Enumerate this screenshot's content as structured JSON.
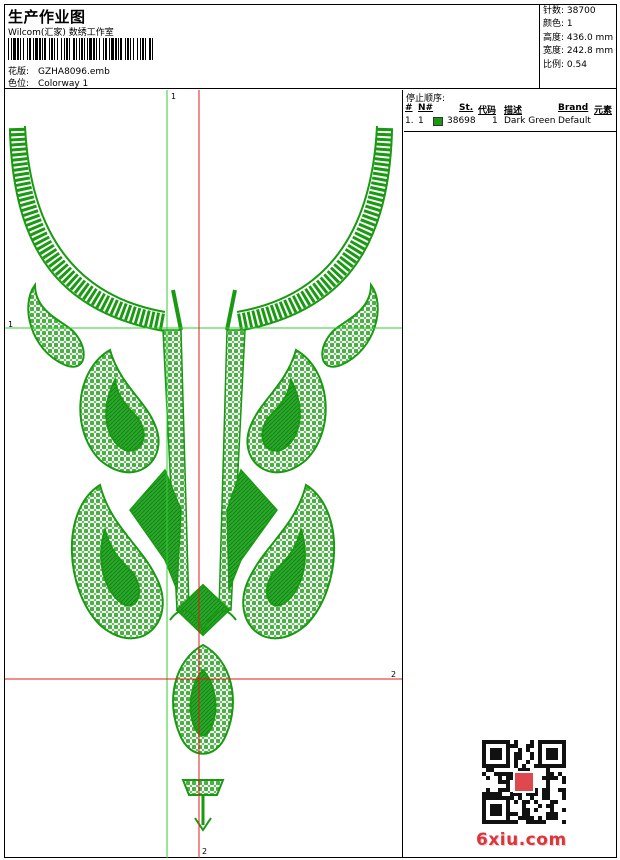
{
  "header": {
    "title": "生产作业图",
    "subtitle": "Wilcom(汇家) 数绣工作室",
    "design_label": "花版:",
    "design_value": "GZHA8096.emb",
    "color_label": "色位:",
    "color_value": "Colorway 1"
  },
  "stats": [
    {
      "label": "针数",
      "value": "38700"
    },
    {
      "label": "颜色",
      "value": "1"
    },
    {
      "label": "高度",
      "value": "436.0 mm"
    },
    {
      "label": "宽度",
      "value": "242.8 mm"
    },
    {
      "label": "比例",
      "value": "0.54"
    }
  ],
  "stop_sequence": {
    "title": "停止顺序:",
    "columns": [
      "#",
      "N#",
      "St.",
      "代码",
      "描述",
      "Brand",
      "元素"
    ],
    "rows": [
      {
        "num": "1.",
        "needle": "1",
        "swatch_color": "#1a9a12",
        "stitches": "38698",
        "code": "1",
        "description": "Dark Green",
        "brand": "Default",
        "elements": ""
      }
    ]
  },
  "guides": {
    "vertical_green_label": "1",
    "horizontal_green_label": "1",
    "horizontal_red_label": "2",
    "vertical_red_label": "2"
  },
  "watermark": "6xiu.com",
  "colors": {
    "thread": "#1a9a12",
    "guide_green": "#33cc33",
    "guide_red": "#e31b1b",
    "watermark": "#d9363e"
  }
}
